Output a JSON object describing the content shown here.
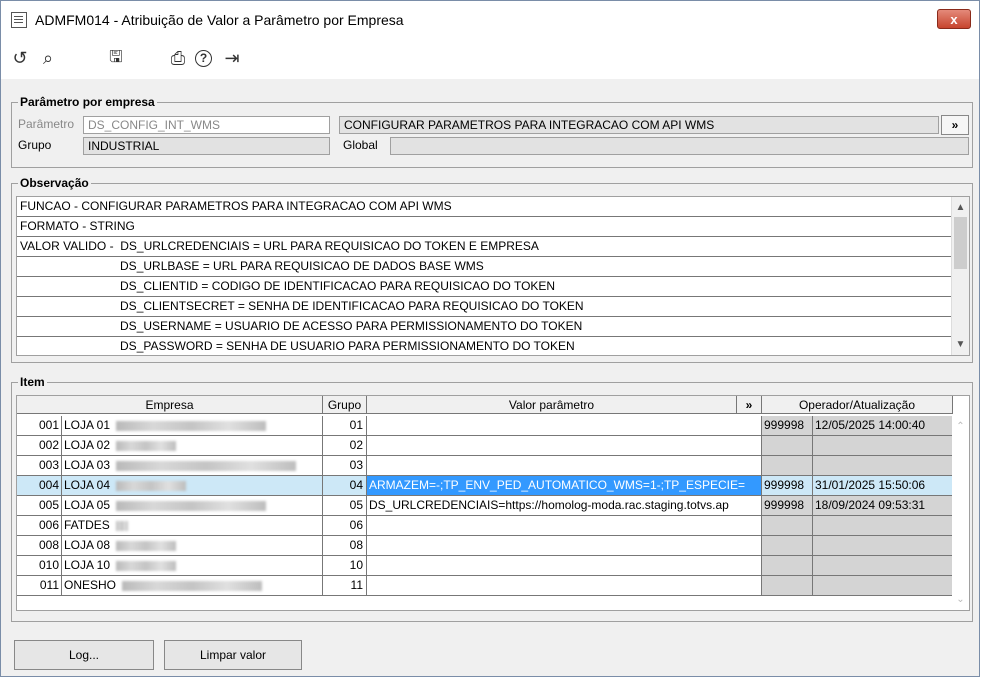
{
  "window": {
    "title": "ADMFM014 - Atribuição de Valor a Parâmetro por Empresa",
    "close_label": "x"
  },
  "toolbar": {
    "undo": "↺",
    "search": "⌕",
    "save": "🖫",
    "print": "⎙",
    "help": "?",
    "exit": "⇥"
  },
  "param_section": {
    "legend": "Parâmetro por empresa",
    "param_label": "Parâmetro",
    "param_value": "DS_CONFIG_INT_WMS",
    "description": "CONFIGURAR PARAMETROS PARA INTEGRACAO COM API WMS",
    "more_label": "»",
    "group_label": "Grupo",
    "group_value": "INDUSTRIAL",
    "global_label": "Global",
    "global_value": ""
  },
  "observacao": {
    "legend": "Observação",
    "lines": [
      "FUNCAO - CONFIGURAR PARAMETROS PARA INTEGRACAO COM API WMS",
      "FORMATO - STRING",
      "VALOR VALIDO -  DS_URLCREDENCIAIS = URL PARA REQUISICAO DO TOKEN E EMPRESA",
      "                              DS_URLBASE = URL PARA REQUISICAO DE DADOS BASE WMS",
      "                              DS_CLIENTID = CODIGO DE IDENTIFICACAO PARA REQUISICAO DO TOKEN",
      "                              DS_CLIENTSECRET = SENHA DE IDENTIFICACAO PARA REQUISICAO DO TOKEN",
      "                              DS_USERNAME = USUARIO DE ACESSO PARA PERMISSIONAMENTO DO TOKEN",
      "                              DS_PASSWORD = SENHA DE USUARIO PARA PERMISSIONAMENTO DO TOKEN"
    ]
  },
  "item": {
    "legend": "Item",
    "headers": {
      "empresa": "Empresa",
      "grupo": "Grupo",
      "valor": "Valor parâmetro",
      "more": "»",
      "operador": "Operador/Atualização"
    },
    "rows": [
      {
        "code": "001",
        "name": "LOJA 01",
        "grupo": "01",
        "valor": "",
        "operador": "999998",
        "data": "12/05/2025 14:00:40"
      },
      {
        "code": "002",
        "name": "LOJA 02",
        "grupo": "02",
        "valor": "",
        "operador": "",
        "data": ""
      },
      {
        "code": "003",
        "name": "LOJA 03",
        "grupo": "03",
        "valor": "",
        "operador": "",
        "data": ""
      },
      {
        "code": "004",
        "name": "LOJA 04",
        "grupo": "04",
        "valor": "ARMAZEM=-;TP_ENV_PED_AUTOMATICO_WMS=1-;TP_ESPECIE=",
        "operador": "999998",
        "data": "31/01/2025 15:50:06"
      },
      {
        "code": "005",
        "name": "LOJA 05",
        "grupo": "05",
        "valor": "DS_URLCREDENCIAIS=https://homolog-moda.rac.staging.totvs.ap",
        "operador": "999998",
        "data": "18/09/2024 09:53:31"
      },
      {
        "code": "006",
        "name": "FATDES",
        "grupo": "06",
        "valor": "",
        "operador": "",
        "data": ""
      },
      {
        "code": "008",
        "name": "LOJA 08",
        "grupo": "08",
        "valor": "",
        "operador": "",
        "data": ""
      },
      {
        "code": "010",
        "name": "LOJA 10",
        "grupo": "10",
        "valor": "",
        "operador": "",
        "data": ""
      },
      {
        "code": "011",
        "name": "ONESHO",
        "grupo": "11",
        "valor": "",
        "operador": "",
        "data": ""
      }
    ]
  },
  "buttons": {
    "log": "Log...",
    "limpar": "Limpar valor"
  }
}
